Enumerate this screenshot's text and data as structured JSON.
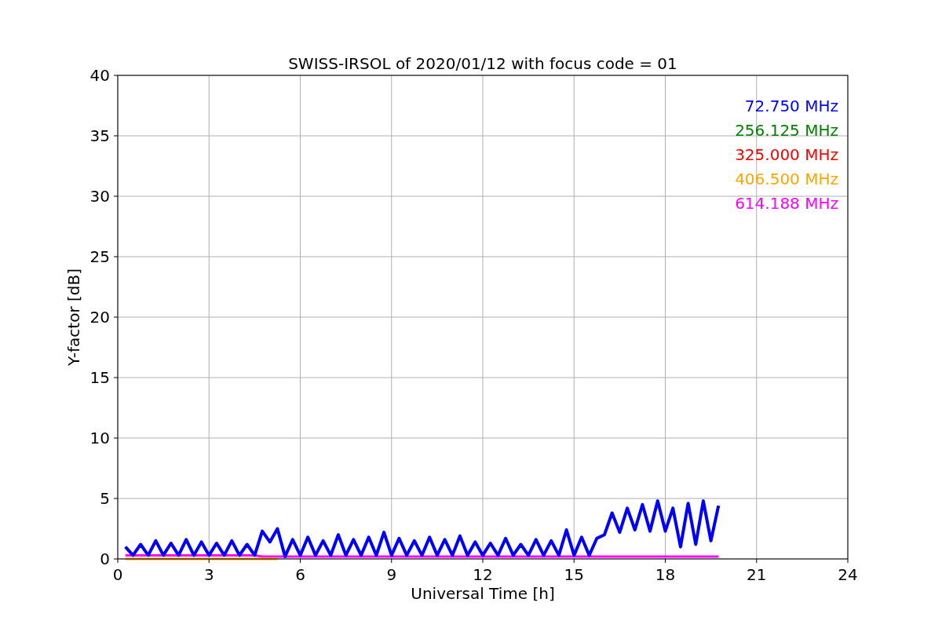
{
  "chart_data": {
    "type": "line",
    "title": "SWISS-IRSOL of 2020/01/12 with focus code = 01",
    "xlabel": "Universal Time [h]",
    "ylabel": "Y-factor [dB]",
    "xlim": [
      0,
      24
    ],
    "ylim": [
      0,
      40
    ],
    "xticks": [
      0,
      3,
      6,
      9,
      12,
      15,
      18,
      21,
      24
    ],
    "yticks": [
      0,
      5,
      10,
      15,
      20,
      25,
      30,
      35,
      40
    ],
    "grid": true,
    "x": [
      0.25,
      0.5,
      0.75,
      1,
      1.25,
      1.5,
      1.75,
      2,
      2.25,
      2.5,
      2.75,
      3,
      3.25,
      3.5,
      3.75,
      4,
      4.25,
      4.5,
      4.75,
      5,
      5.25,
      5.5,
      5.75,
      6,
      6.25,
      6.5,
      6.75,
      7,
      7.25,
      7.5,
      7.75,
      8,
      8.25,
      8.5,
      8.75,
      9,
      9.25,
      9.5,
      9.75,
      10,
      10.25,
      10.5,
      10.75,
      11,
      11.25,
      11.5,
      11.75,
      12,
      12.25,
      12.5,
      12.75,
      13,
      13.25,
      13.5,
      13.75,
      14,
      14.25,
      14.5,
      14.75,
      15,
      15.25,
      15.5,
      15.75,
      16,
      16.25,
      16.5,
      16.75,
      17,
      17.25,
      17.5,
      17.75,
      18,
      18.25,
      18.5,
      18.75,
      19,
      19.25,
      19.5,
      19.75
    ],
    "series": [
      {
        "name": "72.750 MHz",
        "color": "#0000ff",
        "values": [
          1.0,
          0.3,
          1.2,
          0.3,
          1.5,
          0.3,
          1.3,
          0.3,
          1.6,
          0.3,
          1.4,
          0.3,
          1.3,
          0.3,
          1.5,
          0.3,
          1.2,
          0.3,
          2.3,
          1.4,
          2.5,
          0.2,
          1.6,
          0.3,
          1.8,
          0.3,
          1.5,
          0.3,
          2.0,
          0.3,
          1.6,
          0.3,
          1.8,
          0.3,
          2.2,
          0.3,
          1.7,
          0.3,
          1.5,
          0.3,
          1.8,
          0.3,
          1.6,
          0.3,
          1.9,
          0.3,
          1.4,
          0.3,
          1.3,
          0.3,
          1.7,
          0.3,
          1.2,
          0.3,
          1.6,
          0.3,
          1.5,
          0.3,
          2.4,
          0.3,
          1.8,
          0.3,
          1.7,
          2.0,
          3.8,
          2.2,
          4.2,
          2.4,
          4.5,
          2.3,
          4.8,
          2.3,
          4.2,
          1.0,
          4.6,
          1.2,
          4.8,
          1.5,
          4.4
        ]
      },
      {
        "name": "256.125 MHz",
        "color": "#008000",
        "values": [
          null,
          null,
          null,
          null,
          null,
          null,
          null,
          null,
          null,
          null,
          null,
          null,
          null,
          null,
          null,
          null,
          null,
          null,
          null,
          null,
          null,
          null,
          null,
          null,
          null,
          null,
          null,
          null,
          null,
          null,
          null,
          null,
          null,
          null,
          null,
          null,
          null,
          null,
          null,
          null,
          null,
          null,
          null,
          null,
          null,
          null,
          null,
          null,
          null,
          null,
          null,
          null,
          null,
          null,
          null,
          null,
          null,
          null,
          null,
          null,
          null,
          null,
          null,
          null,
          null,
          null,
          null,
          null,
          null,
          null,
          null,
          null,
          null,
          null,
          null,
          null,
          null,
          null,
          null
        ]
      },
      {
        "name": "325.000 MHz",
        "color": "#ff0000",
        "values": [
          null,
          null,
          null,
          null,
          null,
          null,
          null,
          null,
          null,
          null,
          null,
          null,
          null,
          null,
          null,
          null,
          null,
          null,
          null,
          null,
          null,
          null,
          null,
          null,
          null,
          null,
          null,
          null,
          null,
          null,
          null,
          null,
          null,
          null,
          null,
          null,
          null,
          null,
          null,
          null,
          null,
          null,
          null,
          null,
          null,
          null,
          null,
          null,
          null,
          null,
          null,
          null,
          null,
          null,
          null,
          null,
          null,
          null,
          null,
          null,
          null,
          null,
          null,
          null,
          null,
          null,
          null,
          null,
          null,
          null,
          null,
          null,
          null,
          null,
          null,
          null,
          null,
          null,
          null
        ]
      },
      {
        "name": "406.500 MHz",
        "color": "#ffa500",
        "values": [
          0.0,
          0.0,
          0.0,
          0.0,
          0.0,
          0.0,
          0.0,
          0.0,
          0.0,
          0.0,
          0.0,
          0.0,
          0.0,
          0.0,
          0.0,
          0.0,
          0.0,
          0.0,
          0.0,
          0.0,
          0.0,
          null,
          null,
          null,
          null,
          null,
          null,
          null,
          null,
          null,
          null,
          null,
          null,
          null,
          null,
          null,
          null,
          null,
          null,
          null,
          null,
          null,
          null,
          null,
          null,
          null,
          null,
          null,
          null,
          null,
          null,
          null,
          null,
          null,
          null,
          null,
          null,
          null,
          null,
          null,
          null,
          null,
          null,
          null,
          null,
          null,
          null,
          null,
          null,
          null,
          null,
          null,
          null,
          null,
          null,
          null,
          null,
          null,
          null
        ]
      },
      {
        "name": "614.188 MHz",
        "color": "#ff00ff",
        "values": [
          0.3,
          0.3,
          0.3,
          0.3,
          0.3,
          0.3,
          0.3,
          0.3,
          0.3,
          0.3,
          0.3,
          0.3,
          0.3,
          0.3,
          0.3,
          0.3,
          0.3,
          0.3,
          0.2,
          0.2,
          0.2,
          0.2,
          0.2,
          0.2,
          0.2,
          0.2,
          0.2,
          0.2,
          0.2,
          0.2,
          0.2,
          0.2,
          0.2,
          0.2,
          0.2,
          0.2,
          0.2,
          0.2,
          0.2,
          0.2,
          0.2,
          0.2,
          0.2,
          0.2,
          0.2,
          0.2,
          0.2,
          0.2,
          0.2,
          0.2,
          0.2,
          0.2,
          0.2,
          0.2,
          0.2,
          0.2,
          0.2,
          0.2,
          0.2,
          0.2,
          0.2,
          0.2,
          0.2,
          0.2,
          0.2,
          0.2,
          0.2,
          0.2,
          0.2,
          0.2,
          0.2,
          0.2,
          0.2,
          0.2,
          0.2,
          0.2,
          0.2,
          0.2,
          0.2
        ]
      }
    ]
  }
}
